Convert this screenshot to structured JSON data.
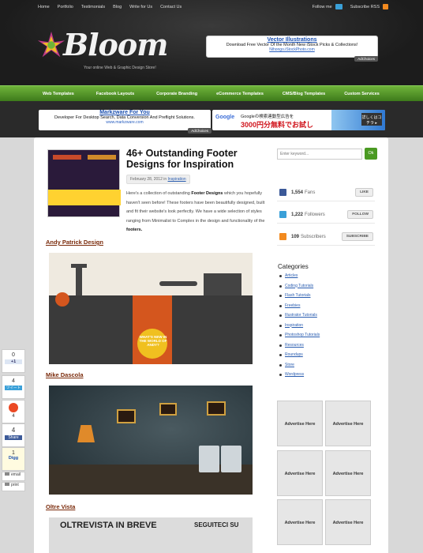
{
  "topnav": [
    "Home",
    "Portfolio",
    "Testimonials",
    "Blog",
    "Write for Us",
    "Contact Us"
  ],
  "follow": {
    "follow_label": "Follow me",
    "rss_label": "Subscribe RSS"
  },
  "logo": {
    "text": "Bloom",
    "tagline": "Your online Web & Graphic Design Store!"
  },
  "ad_top": {
    "title": "Vector Illustrations",
    "text": "Download Free Vector Of the Month New iStock Picks & Collections!",
    "url": "Nihongo.iStockPhoto.com",
    "adchoices": "AdChoices"
  },
  "mainnav": [
    "Web Templates",
    "Facebook Layouts",
    "Corporate Branding",
    "eCommerce Templates",
    "CMS/Blog Templates",
    "Custom Services"
  ],
  "ad_left": {
    "title": "Markzware For You",
    "text": "Developer For Desktop Search, Data Conversion And Preflight Solutions.",
    "url": "www.markzware.com",
    "adchoices": "AdChoices"
  },
  "ad_right": {
    "brand": "Google",
    "line1": "Googleの検索連動型広告を",
    "line2": "3000円分無料でお試し",
    "btn": "詳しくはコチラ ▸"
  },
  "post": {
    "title": "46+ Outstanding Footer Designs for Inspiration",
    "date": "February 28, 2012 in",
    "category": "Inspiration",
    "intro_1": "Here's a collection of outstanding",
    "intro_bold": "Footer Designs",
    "intro_2": "which you hopefully haven't seen before! These footers have been beautifully designed, built and fit their website's look perfectly. We have a wide selection of styles ranging from Minimalist to Complex in the design and functionality of the",
    "intro_bold2": "footers.",
    "sections": [
      "Andy Patrick Design",
      "Mike Dascola",
      "Oltre Vista"
    ],
    "shot1_text": "WHAT'S NEW IN THE WORLD OF ANDY?",
    "shot3_left": "OLTREVISTA IN BREVE",
    "shot3_right": "SEGUITECI SU"
  },
  "sidebar": {
    "search_placeholder": "Enter keyword...",
    "search_btn": "Ok",
    "social": [
      {
        "num": "1,554",
        "label": "Fans",
        "btn": "LIKE",
        "color": "#3b5998"
      },
      {
        "num": "1,222",
        "label": "Followers",
        "btn": "FOLLOW",
        "color": "#3aa0d8"
      },
      {
        "num": "109",
        "label": "Subscribers",
        "btn": "SUBSCRIBE",
        "color": "#f28a1f"
      }
    ],
    "categories_title": "Categories",
    "categories": [
      "Articles",
      "Coding Tutorials",
      "Flash Tutorials",
      "Freebies",
      "Illustrator Tutorials",
      "Inspiration",
      "Photoshop Tutorials",
      "Resources",
      "Roundups",
      "Store",
      "Wordpress"
    ],
    "advertise": [
      "Advertise Here",
      "Advertise Here",
      "Advertise Here",
      "Advertise Here",
      "Advertise Here",
      "Advertise Here"
    ]
  },
  "share": {
    "plus_count": "0",
    "plus_label": "+1",
    "tweet_count": "4",
    "tweet_label": "ツイート",
    "su_count": "4",
    "fb_count": "4",
    "fb_label": "Share",
    "digg_count": "1",
    "digg_label": "Digg",
    "email_label": "email",
    "print_label": "print"
  },
  "colors": {
    "green": "#4a9a22",
    "link": "#2a5db0",
    "section": "#7a2a0a"
  }
}
